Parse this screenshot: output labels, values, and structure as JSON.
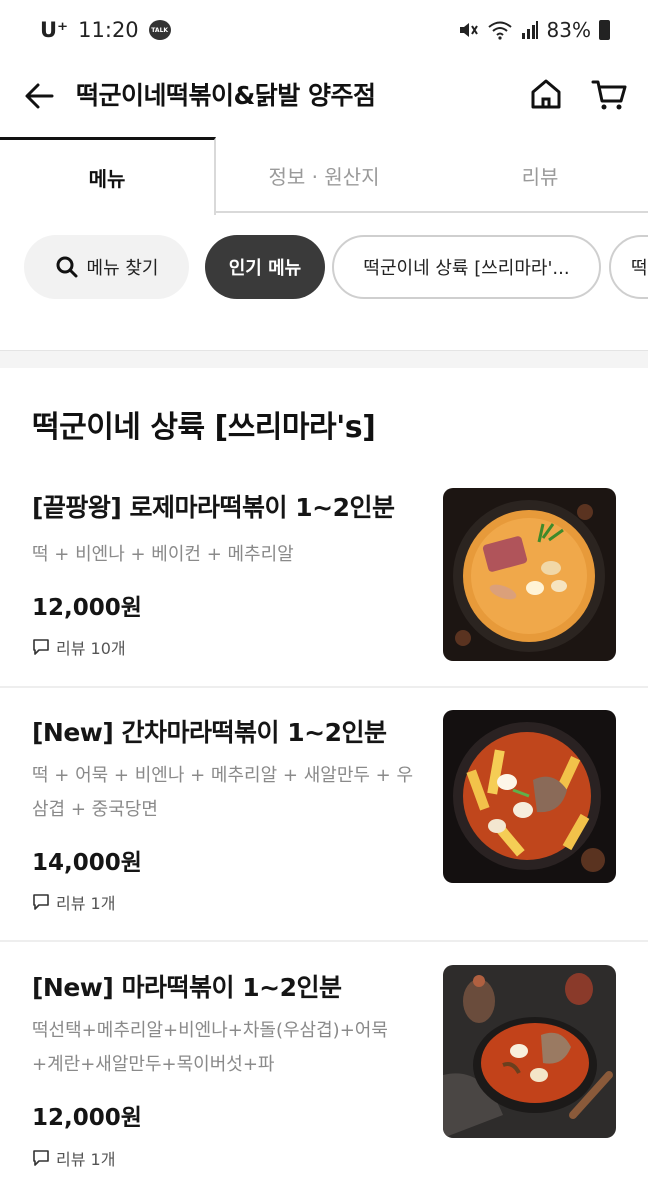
{
  "status_bar": {
    "carrier": "U⁺",
    "time": "11:20",
    "talk_badge": "TALK",
    "battery": "83%",
    "icons": [
      "mute-icon",
      "wifi-icon",
      "signal-icon",
      "battery-icon"
    ]
  },
  "header": {
    "title": "떡군이네떡볶이&닭발 양주점",
    "icons": [
      "back-arrow-icon",
      "home-icon",
      "cart-icon"
    ]
  },
  "tabs": [
    {
      "label": "메뉴",
      "active": true
    },
    {
      "label": "정보 · 원산지",
      "active": false
    },
    {
      "label": "리뷰",
      "active": false
    }
  ],
  "chips": {
    "search_label": "메뉴 찾기",
    "popular_label": "인기 메뉴",
    "category1_label": "떡군이네 상륙 [쓰리마라'...",
    "category2_label": "떡"
  },
  "section": {
    "title": "떡군이네 상륙 [쓰리마라's]"
  },
  "menu_items": [
    {
      "name": "[끝팡왕] 로제마라떡볶이 1~2인분",
      "desc": "떡 + 비엔나 + 베이컨 + 메추리알",
      "price": "12,000원",
      "review": "리뷰 10개"
    },
    {
      "name": "[New] 간차마라떡볶이 1~2인분",
      "desc": "떡 + 어묵 + 비엔나 + 메추리알 + 새알만두 + 우삼겹 + 중국당면",
      "price": "14,000원",
      "review": "리뷰 1개"
    },
    {
      "name": "[New] 마라떡볶이 1~2인분",
      "desc": "떡선택+메추리알+비엔나+차돌(우삼겹)+어묵+계란+새알만두+목이버섯+파",
      "price": "12,000원",
      "review": "리뷰 1개"
    }
  ],
  "colors": {
    "active_chip_bg": "#3a3a3a",
    "muted_text": "#8a8a8a",
    "divider": "#f4f4f4"
  }
}
